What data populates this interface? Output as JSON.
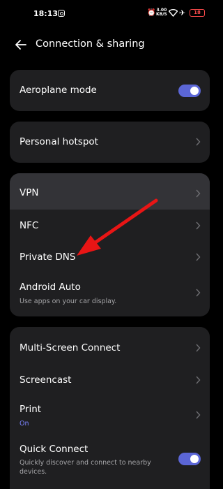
{
  "status_bar": {
    "time": "18:13",
    "network_speed_value": "3.00",
    "network_speed_unit": "KB/S",
    "battery": "18",
    "icons": [
      "instagram-icon",
      "alarm-off-icon",
      "wifi-icon",
      "airplane-icon",
      "battery-icon"
    ]
  },
  "header": {
    "title": "Connection & sharing"
  },
  "cards": {
    "aeroplane": {
      "label": "Aeroplane mode",
      "enabled": true
    },
    "hotspot": {
      "label": "Personal hotspot"
    },
    "network": {
      "vpn": "VPN",
      "nfc": "NFC",
      "private_dns": "Private DNS",
      "android_auto": "Android Auto",
      "android_auto_sub": "Use apps on your car display."
    },
    "sharing": {
      "multi_screen": "Multi-Screen Connect",
      "screencast": "Screencast",
      "print": "Print",
      "print_sub": "On",
      "quick_connect": "Quick Connect",
      "quick_connect_sub": "Quickly discover and connect to nearby devices.",
      "quick_connect_enabled": true
    }
  },
  "colors": {
    "background": "#000000",
    "card": "#1f1f21",
    "highlight": "#333337",
    "toggle_on": "#5b66d6",
    "accent_text": "#7b84ff",
    "annotation_arrow": "#e81515"
  }
}
